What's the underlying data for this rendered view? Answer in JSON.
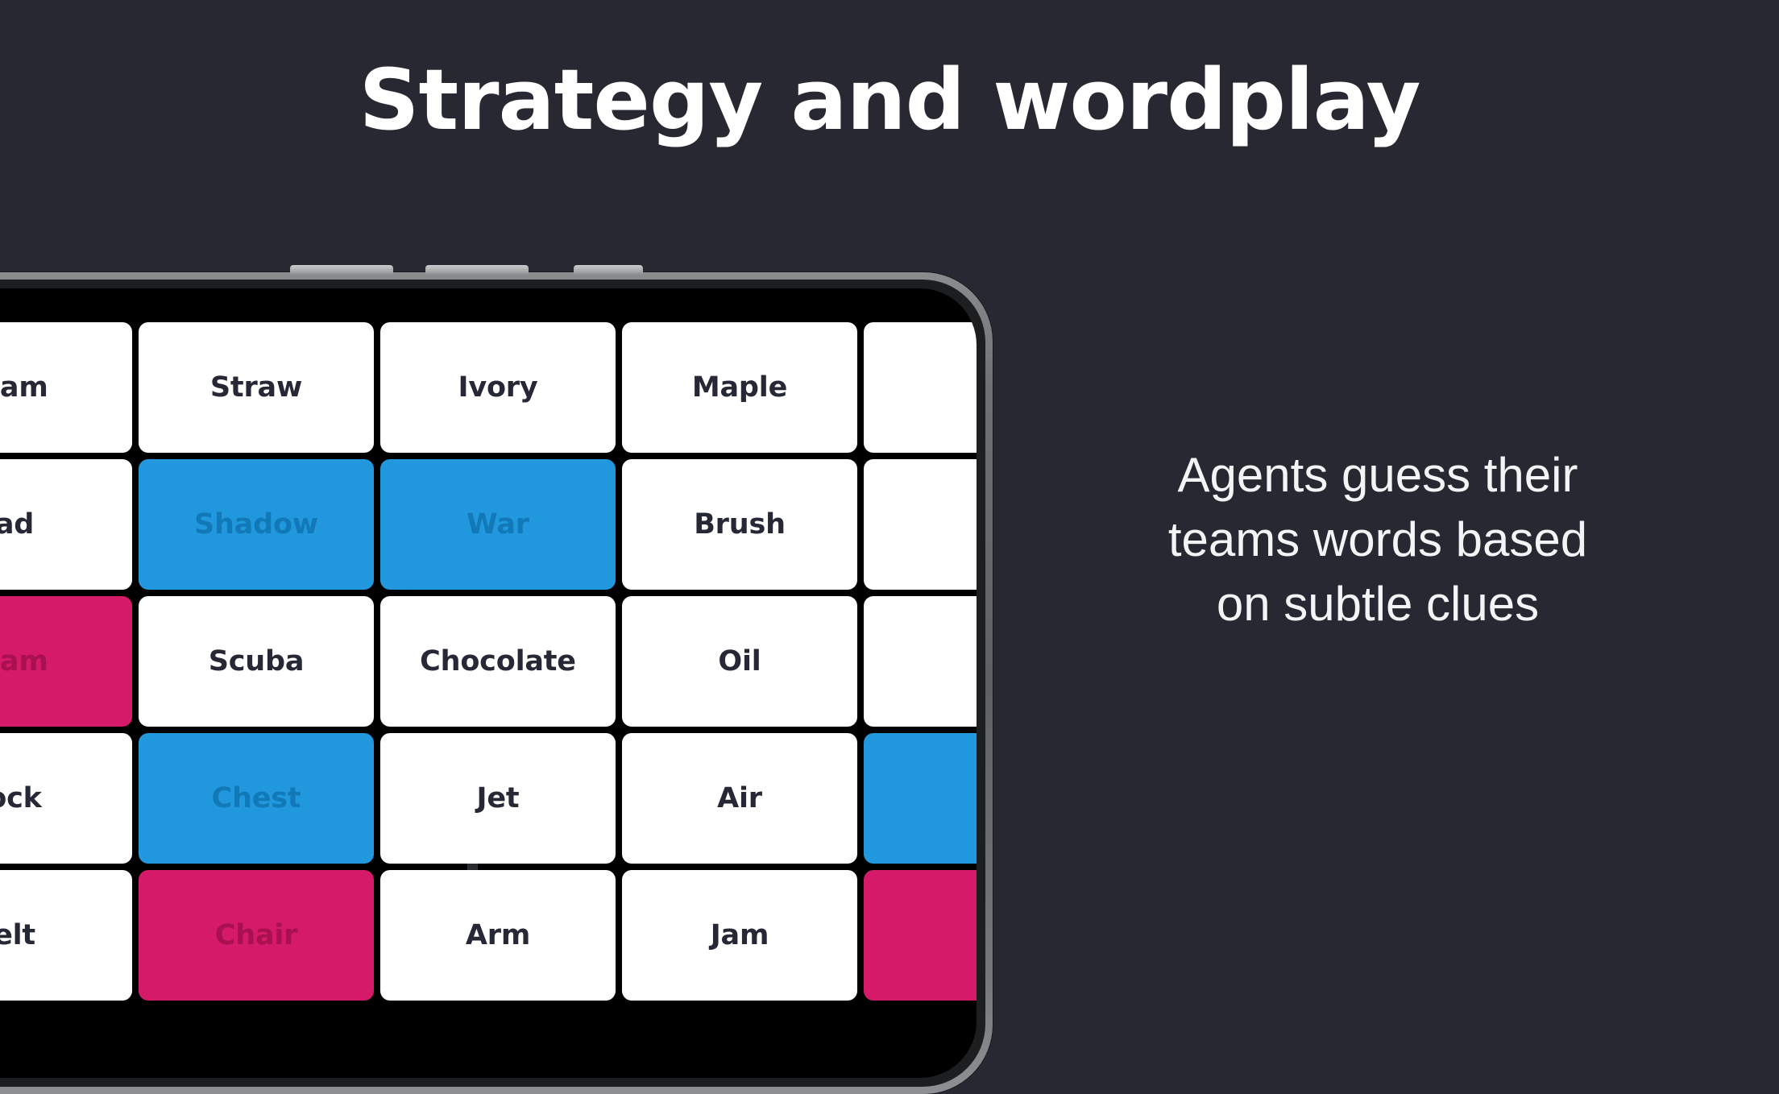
{
  "theme": {
    "background": "#272832",
    "headline_color": "#ffffff",
    "caption_color": "#f3f4f6",
    "card_neutral_bg": "#ffffff",
    "card_neutral_text": "#272836",
    "card_blue_bg": "#2198DE",
    "card_blue_text": "#1179b8",
    "card_pink_bg": "#D41A68",
    "card_pink_text": "#a8104f",
    "phone_frame": "#6e7073",
    "phone_screen": "#000000"
  },
  "headline": {
    "text": "Strategy and wordplay"
  },
  "caption": {
    "line1": "Agents guess their",
    "line2": "teams words based",
    "line3": "on subtle clues"
  },
  "phone": {
    "buttons": [
      {
        "name": "silent-switch"
      },
      {
        "name": "volume-up-button"
      },
      {
        "name": "volume-down-button"
      }
    ],
    "front_camera": "front-camera",
    "earpiece": "earpiece-speaker"
  },
  "board": {
    "columns": 5,
    "rows": 5,
    "cards": [
      {
        "label": "eam",
        "state": "neutral"
      },
      {
        "label": "Straw",
        "state": "neutral"
      },
      {
        "label": "Ivory",
        "state": "neutral"
      },
      {
        "label": "Maple",
        "state": "neutral"
      },
      {
        "label": "",
        "state": "neutral"
      },
      {
        "label": "ad",
        "state": "neutral"
      },
      {
        "label": "Shadow",
        "state": "blue"
      },
      {
        "label": "War",
        "state": "blue"
      },
      {
        "label": "Brush",
        "state": "neutral"
      },
      {
        "label": "",
        "state": "neutral"
      },
      {
        "label": "eam",
        "state": "pink"
      },
      {
        "label": "Scuba",
        "state": "neutral"
      },
      {
        "label": "Chocolate",
        "state": "neutral"
      },
      {
        "label": "Oil",
        "state": "neutral"
      },
      {
        "label": "",
        "state": "neutral"
      },
      {
        "label": "ock",
        "state": "neutral"
      },
      {
        "label": "Chest",
        "state": "blue"
      },
      {
        "label": "Jet",
        "state": "neutral"
      },
      {
        "label": "Air",
        "state": "neutral"
      },
      {
        "label": "",
        "state": "blue"
      },
      {
        "label": "elt",
        "state": "neutral"
      },
      {
        "label": "Chair",
        "state": "pink"
      },
      {
        "label": "Arm",
        "state": "neutral"
      },
      {
        "label": "Jam",
        "state": "neutral"
      },
      {
        "label": "",
        "state": "pink"
      }
    ]
  }
}
